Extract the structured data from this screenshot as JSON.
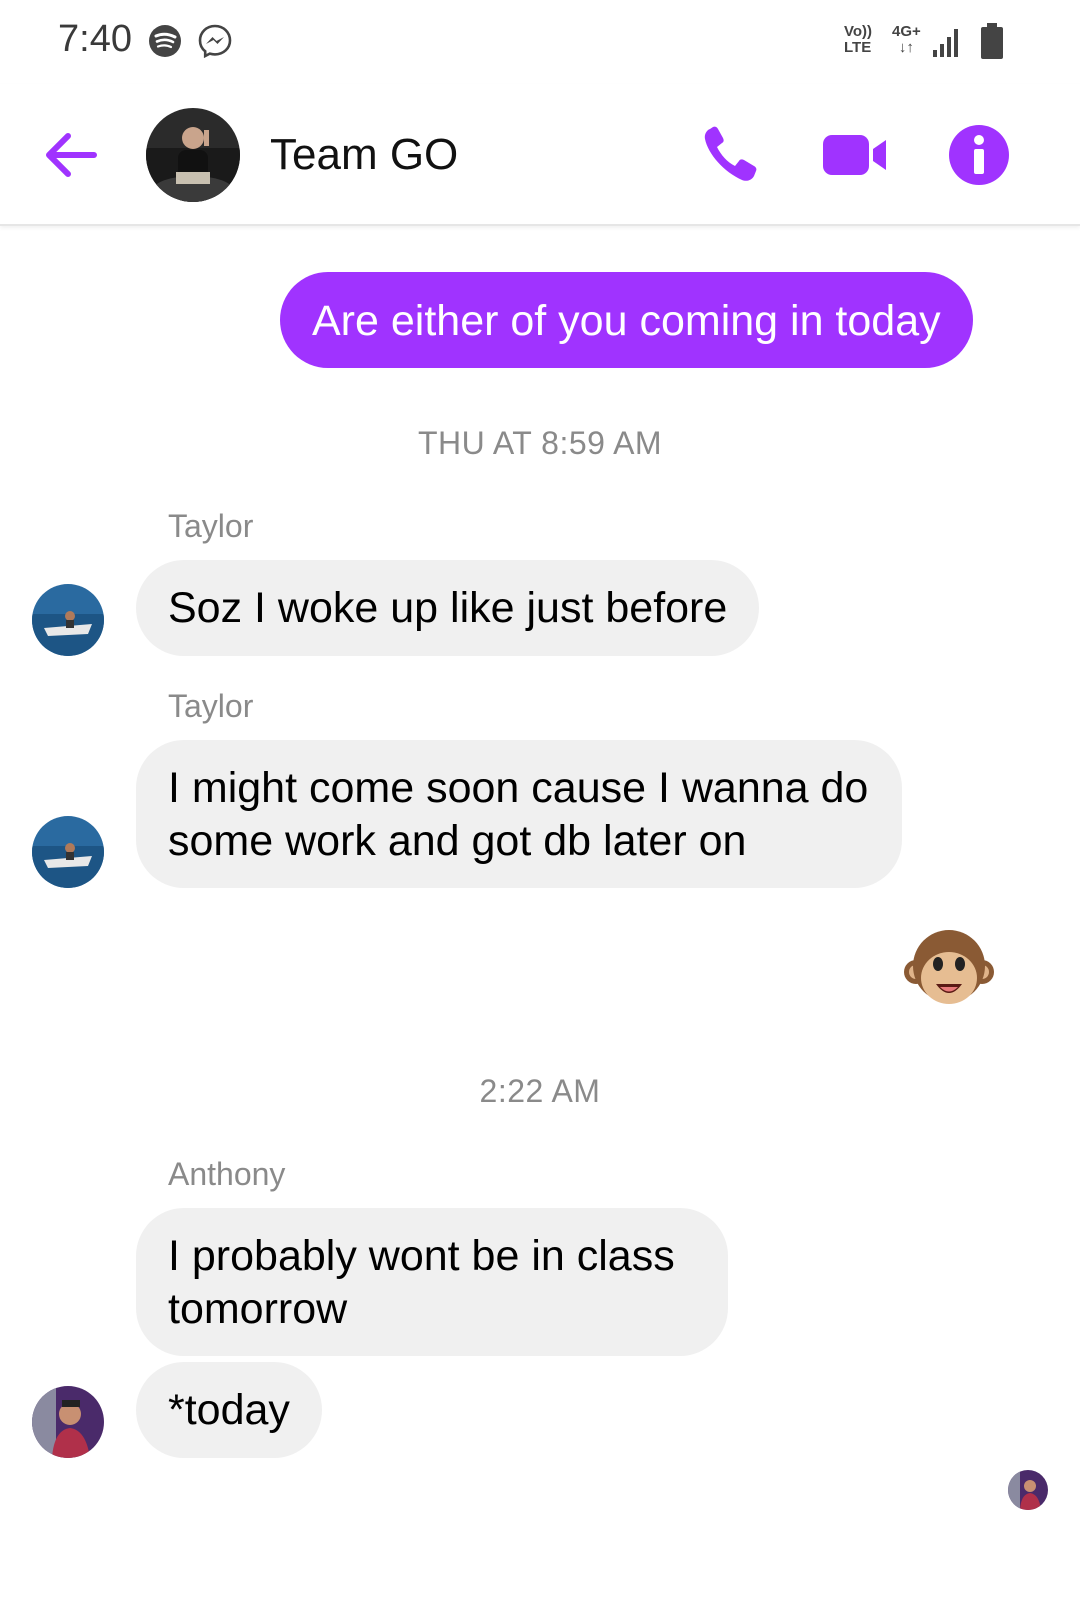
{
  "status_bar": {
    "time": "7:40",
    "volte_line1": "Vo))",
    "volte_line2": "LTE",
    "network_line1": "4G+",
    "network_line2": "↓↑",
    "icons": [
      "spotify-icon",
      "messenger-icon",
      "signal-icon",
      "battery-icon"
    ]
  },
  "header": {
    "title": "Team GO",
    "accent_color": "#a033ff",
    "icons": [
      "back-arrow-icon",
      "phone-icon",
      "video-camera-icon",
      "info-icon"
    ]
  },
  "messages": {
    "outgoing_1": "Are either of you coming in today",
    "timestamp_1": "THU AT 8:59 AM",
    "sender_1": "Taylor",
    "incoming_1": "Soz I woke up like just before",
    "sender_2": "Taylor",
    "incoming_2": "I might come soon cause I wanna do some work and got db later on",
    "reaction_emoji": "🐵",
    "timestamp_2": "2:22 AM",
    "sender_3": "Anthony",
    "incoming_3": "I probably wont be in class tomorrow",
    "incoming_4": "*today"
  }
}
